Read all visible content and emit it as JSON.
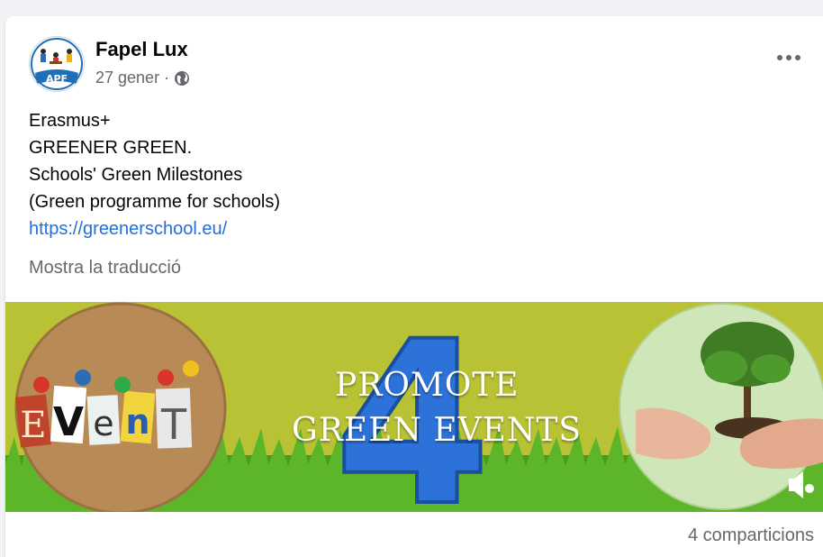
{
  "post": {
    "author": "Fapel Lux",
    "date": "27 gener",
    "separator": "·",
    "avatar_label": "APF",
    "body_lines": [
      "Erasmus+",
      "GREENER GREEN.",
      "Schools' Green Milestones",
      "(Green programme for schools)"
    ],
    "link": "https://greenerschool.eu/",
    "translate_label": "Mostra la traducció",
    "privacy_icon": "globe-icon",
    "menu_icon": "more-options-icon"
  },
  "banner": {
    "event_letters": [
      "E",
      "V",
      "e",
      "n",
      "T"
    ],
    "big_number": "4",
    "line1": "PROMOTE",
    "line2": "GREEN EVENTS",
    "colors": {
      "background": "#b9c234",
      "grass": "#4a9a1e",
      "number": "#2c72d8"
    }
  },
  "footer": {
    "shares": "4 comparticions"
  },
  "colors": {
    "link": "#216fdb",
    "secondary_text": "#65676b",
    "page_bg": "#f0f2f5"
  }
}
